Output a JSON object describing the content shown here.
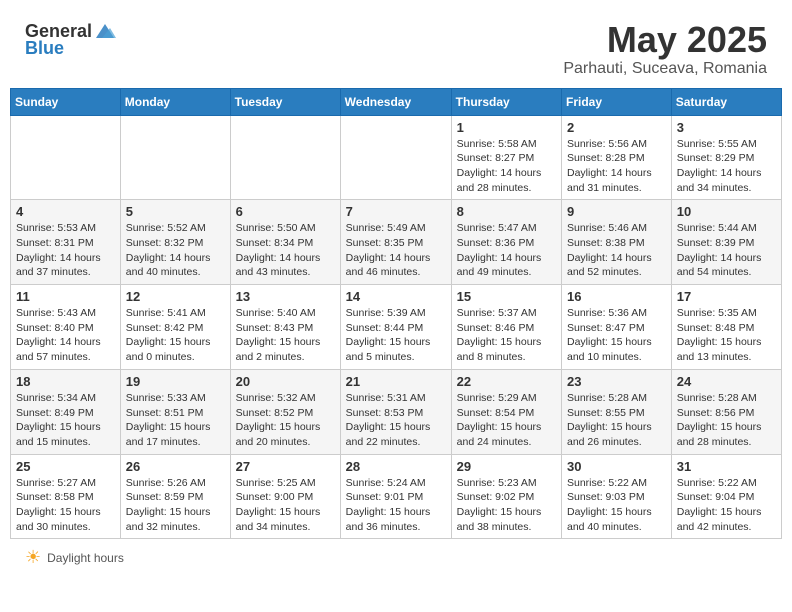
{
  "header": {
    "logo_general": "General",
    "logo_blue": "Blue",
    "month": "May 2025",
    "location": "Parhauti, Suceava, Romania"
  },
  "days_of_week": [
    "Sunday",
    "Monday",
    "Tuesday",
    "Wednesday",
    "Thursday",
    "Friday",
    "Saturday"
  ],
  "weeks": [
    [
      {
        "day": "",
        "info": ""
      },
      {
        "day": "",
        "info": ""
      },
      {
        "day": "",
        "info": ""
      },
      {
        "day": "",
        "info": ""
      },
      {
        "day": "1",
        "info": "Sunrise: 5:58 AM\nSunset: 8:27 PM\nDaylight: 14 hours\nand 28 minutes."
      },
      {
        "day": "2",
        "info": "Sunrise: 5:56 AM\nSunset: 8:28 PM\nDaylight: 14 hours\nand 31 minutes."
      },
      {
        "day": "3",
        "info": "Sunrise: 5:55 AM\nSunset: 8:29 PM\nDaylight: 14 hours\nand 34 minutes."
      }
    ],
    [
      {
        "day": "4",
        "info": "Sunrise: 5:53 AM\nSunset: 8:31 PM\nDaylight: 14 hours\nand 37 minutes."
      },
      {
        "day": "5",
        "info": "Sunrise: 5:52 AM\nSunset: 8:32 PM\nDaylight: 14 hours\nand 40 minutes."
      },
      {
        "day": "6",
        "info": "Sunrise: 5:50 AM\nSunset: 8:34 PM\nDaylight: 14 hours\nand 43 minutes."
      },
      {
        "day": "7",
        "info": "Sunrise: 5:49 AM\nSunset: 8:35 PM\nDaylight: 14 hours\nand 46 minutes."
      },
      {
        "day": "8",
        "info": "Sunrise: 5:47 AM\nSunset: 8:36 PM\nDaylight: 14 hours\nand 49 minutes."
      },
      {
        "day": "9",
        "info": "Sunrise: 5:46 AM\nSunset: 8:38 PM\nDaylight: 14 hours\nand 52 minutes."
      },
      {
        "day": "10",
        "info": "Sunrise: 5:44 AM\nSunset: 8:39 PM\nDaylight: 14 hours\nand 54 minutes."
      }
    ],
    [
      {
        "day": "11",
        "info": "Sunrise: 5:43 AM\nSunset: 8:40 PM\nDaylight: 14 hours\nand 57 minutes."
      },
      {
        "day": "12",
        "info": "Sunrise: 5:41 AM\nSunset: 8:42 PM\nDaylight: 15 hours\nand 0 minutes."
      },
      {
        "day": "13",
        "info": "Sunrise: 5:40 AM\nSunset: 8:43 PM\nDaylight: 15 hours\nand 2 minutes."
      },
      {
        "day": "14",
        "info": "Sunrise: 5:39 AM\nSunset: 8:44 PM\nDaylight: 15 hours\nand 5 minutes."
      },
      {
        "day": "15",
        "info": "Sunrise: 5:37 AM\nSunset: 8:46 PM\nDaylight: 15 hours\nand 8 minutes."
      },
      {
        "day": "16",
        "info": "Sunrise: 5:36 AM\nSunset: 8:47 PM\nDaylight: 15 hours\nand 10 minutes."
      },
      {
        "day": "17",
        "info": "Sunrise: 5:35 AM\nSunset: 8:48 PM\nDaylight: 15 hours\nand 13 minutes."
      }
    ],
    [
      {
        "day": "18",
        "info": "Sunrise: 5:34 AM\nSunset: 8:49 PM\nDaylight: 15 hours\nand 15 minutes."
      },
      {
        "day": "19",
        "info": "Sunrise: 5:33 AM\nSunset: 8:51 PM\nDaylight: 15 hours\nand 17 minutes."
      },
      {
        "day": "20",
        "info": "Sunrise: 5:32 AM\nSunset: 8:52 PM\nDaylight: 15 hours\nand 20 minutes."
      },
      {
        "day": "21",
        "info": "Sunrise: 5:31 AM\nSunset: 8:53 PM\nDaylight: 15 hours\nand 22 minutes."
      },
      {
        "day": "22",
        "info": "Sunrise: 5:29 AM\nSunset: 8:54 PM\nDaylight: 15 hours\nand 24 minutes."
      },
      {
        "day": "23",
        "info": "Sunrise: 5:28 AM\nSunset: 8:55 PM\nDaylight: 15 hours\nand 26 minutes."
      },
      {
        "day": "24",
        "info": "Sunrise: 5:28 AM\nSunset: 8:56 PM\nDaylight: 15 hours\nand 28 minutes."
      }
    ],
    [
      {
        "day": "25",
        "info": "Sunrise: 5:27 AM\nSunset: 8:58 PM\nDaylight: 15 hours\nand 30 minutes."
      },
      {
        "day": "26",
        "info": "Sunrise: 5:26 AM\nSunset: 8:59 PM\nDaylight: 15 hours\nand 32 minutes."
      },
      {
        "day": "27",
        "info": "Sunrise: 5:25 AM\nSunset: 9:00 PM\nDaylight: 15 hours\nand 34 minutes."
      },
      {
        "day": "28",
        "info": "Sunrise: 5:24 AM\nSunset: 9:01 PM\nDaylight: 15 hours\nand 36 minutes."
      },
      {
        "day": "29",
        "info": "Sunrise: 5:23 AM\nSunset: 9:02 PM\nDaylight: 15 hours\nand 38 minutes."
      },
      {
        "day": "30",
        "info": "Sunrise: 5:22 AM\nSunset: 9:03 PM\nDaylight: 15 hours\nand 40 minutes."
      },
      {
        "day": "31",
        "info": "Sunrise: 5:22 AM\nSunset: 9:04 PM\nDaylight: 15 hours\nand 42 minutes."
      }
    ]
  ],
  "footer": {
    "daylight_label": "Daylight hours"
  }
}
